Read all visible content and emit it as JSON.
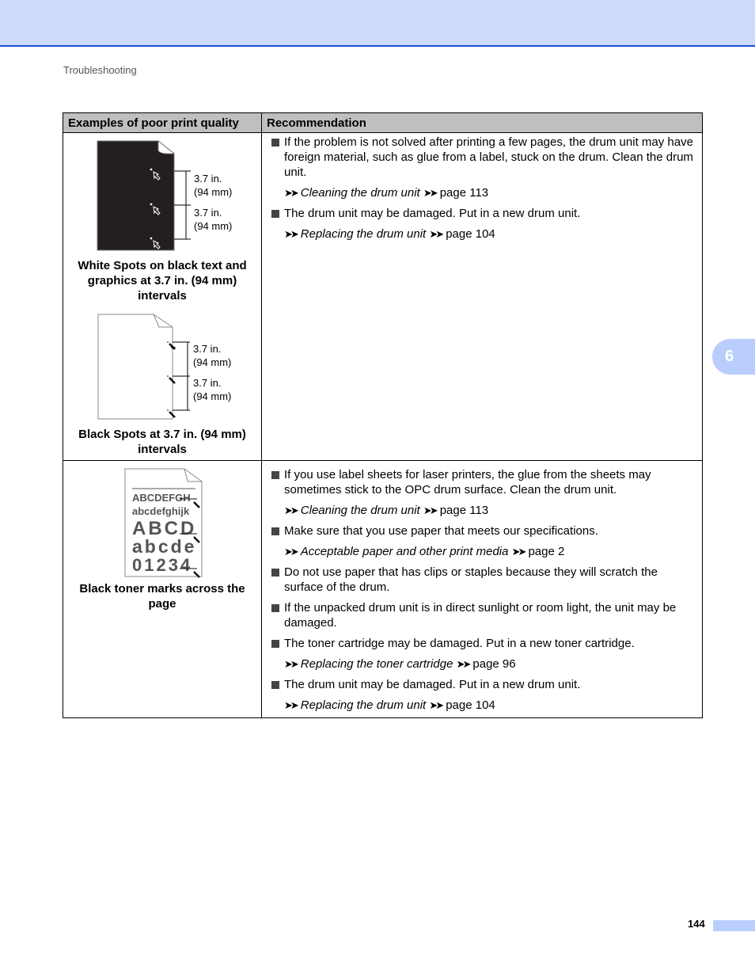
{
  "header": {
    "breadcrumb": "Troubleshooting"
  },
  "chapter_tab": {
    "label": "6"
  },
  "footer": {
    "page_number": "144"
  },
  "table": {
    "headers": [
      "Examples of poor print quality",
      "Recommendation"
    ],
    "rows": [
      {
        "examples": [
          {
            "caption": "White Spots on black text and graphics at 3.7 in. (94 mm) intervals",
            "dim1_a": "3.7 in.",
            "dim1_b": "(94 mm)",
            "dim2_a": "3.7 in.",
            "dim2_b": "(94 mm)"
          },
          {
            "caption": "Black Spots at 3.7 in. (94 mm) intervals",
            "dim1_a": "3.7 in.",
            "dim1_b": "(94 mm)",
            "dim2_a": "3.7 in.",
            "dim2_b": "(94 mm)"
          }
        ],
        "recommendations": [
          {
            "text": "If the problem is not solved after printing a few pages, the drum unit may have foreign material, such as glue from a label, stuck on the drum. Clean the drum unit.",
            "ref_title": "Cleaning the drum unit",
            "ref_page": "page 113"
          },
          {
            "text": "The drum unit may be damaged. Put in a new drum unit.",
            "ref_title": "Replacing the drum unit",
            "ref_page": "page 104"
          }
        ]
      },
      {
        "examples": [
          {
            "caption": "Black toner marks across the page",
            "sample_lines": [
              "ABCDEFGH",
              "abcdefghijk",
              "ABCD",
              "abcde",
              "01234"
            ]
          }
        ],
        "recommendations": [
          {
            "text": "If you use label sheets for laser printers, the glue from the sheets may sometimes stick to the OPC drum surface. Clean the drum unit.",
            "ref_title": "Cleaning the drum unit",
            "ref_page": "page 113"
          },
          {
            "text": "Make sure that you use paper that meets our specifications.",
            "ref_title": "Acceptable paper and other print media",
            "ref_page": "page 2"
          },
          {
            "text": "Do not use paper that has clips or staples because they will scratch the surface of the drum."
          },
          {
            "text": "If the unpacked drum unit is in direct sunlight or room light, the unit may be damaged."
          },
          {
            "text": "The toner cartridge may be damaged. Put in a new toner cartridge.",
            "ref_title": "Replacing the toner cartridge",
            "ref_page": "page 96"
          },
          {
            "text": "The drum unit may be damaged. Put in a new drum unit.",
            "ref_title": "Replacing the drum unit",
            "ref_page": "page 104"
          }
        ]
      }
    ]
  },
  "ref_arrow_glyph": "➤➤"
}
